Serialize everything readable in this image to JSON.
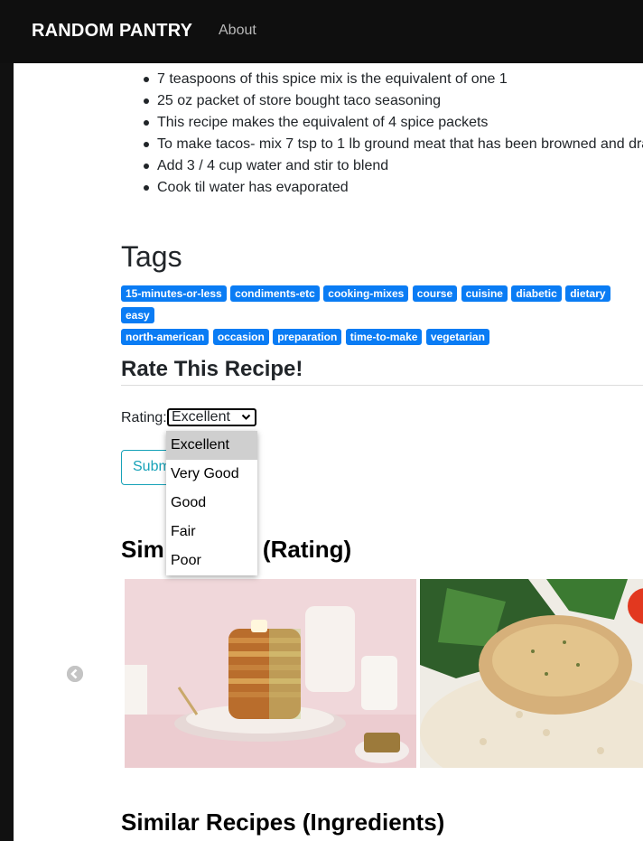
{
  "navbar": {
    "brand": "RANDOM PANTRY",
    "about": "About"
  },
  "steps": [
    "7 teaspoons of this spice mix is the equivalent of one 1",
    "25 oz packet of store bought taco seasoning",
    "This recipe makes the equivalent of 4 spice packets",
    "To make tacos- mix 7 tsp to 1 lb ground meat that has been browned and dra",
    "Add 3 / 4 cup water and stir to blend",
    "Cook til water has evaporated"
  ],
  "tags": {
    "heading": "Tags",
    "items": [
      "15-minutes-or-less",
      "condiments-etc",
      "cooking-mixes",
      "course",
      "cuisine",
      "diabetic",
      "dietary",
      "easy",
      "north-american",
      "occasion",
      "preparation",
      "time-to-make",
      "vegetarian"
    ]
  },
  "rating_form": {
    "heading": "Rate This Recipe!",
    "label": "Rating:",
    "selected": "Excellent",
    "options": [
      "Excellent",
      "Very Good",
      "Good",
      "Fair",
      "Poor"
    ],
    "submit_visible_prefix": "Subm"
  },
  "similar_rating": {
    "heading_left": "Sim",
    "heading_right": "ipes (Rating)"
  },
  "similar_ingredients": {
    "heading": "Similar Recipes (Ingredients)"
  },
  "icons": {
    "prev": "chevron-left-circle-icon",
    "select": "chevron-down-icon"
  }
}
